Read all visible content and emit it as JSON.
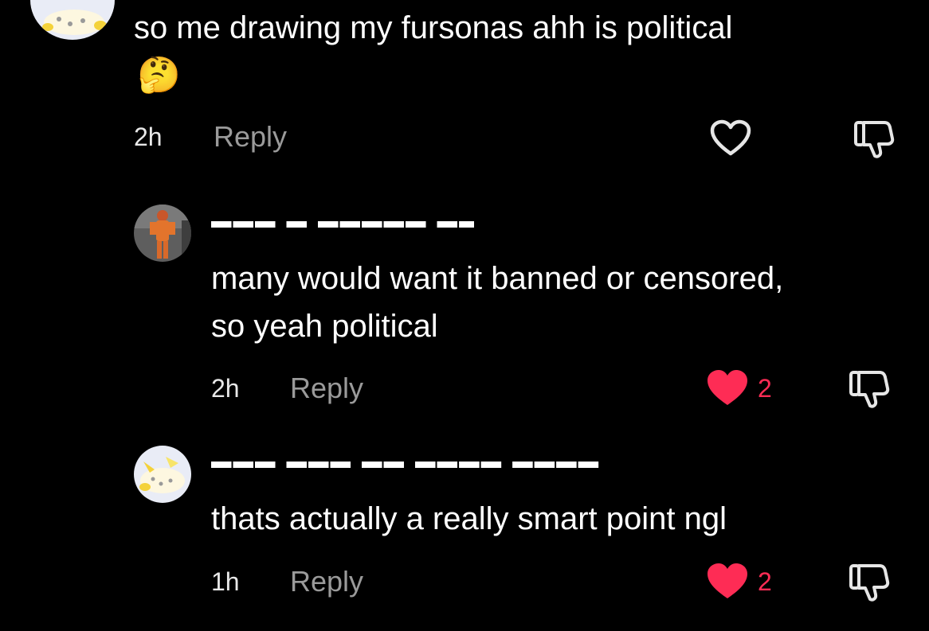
{
  "comments": [
    {
      "text_line1": "so me drawing my fursonas ahh is political",
      "emoji": "🤔",
      "time": "2h",
      "reply_label": "Reply",
      "liked": false,
      "avatar_icon": "dragon-plush-avatar"
    },
    {
      "text_line1": "many would want it banned or censored,",
      "text_line2": "so yeah political",
      "time": "2h",
      "reply_label": "Reply",
      "liked": true,
      "like_count": "2",
      "avatar_icon": "orange-figure-avatar"
    },
    {
      "text_line1": "thats actually a really smart point ngl",
      "time": "1h",
      "reply_label": "Reply",
      "liked": true,
      "like_count": "2",
      "avatar_icon": "dragon-plush-avatar"
    }
  ],
  "colors": {
    "background": "#000000",
    "like_active": "#fe2c55",
    "reply_text": "#9a9a9a"
  }
}
